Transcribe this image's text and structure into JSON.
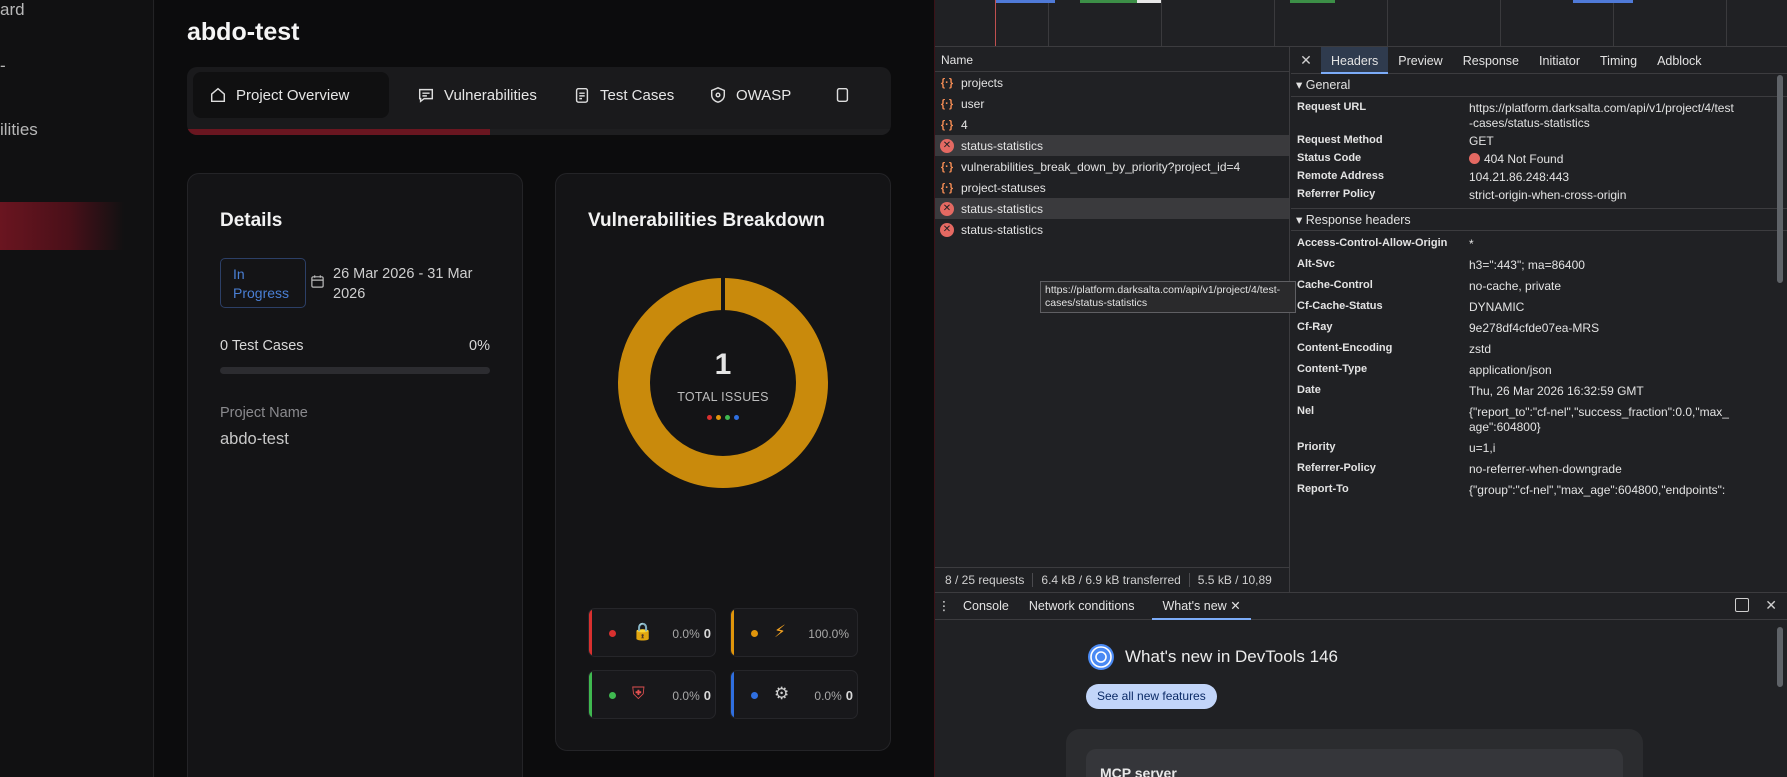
{
  "app": {
    "sidebar": {
      "items": [
        "ard",
        "",
        "ilities"
      ]
    },
    "project_title": "abdo-test",
    "tabs": [
      {
        "label": "Project Overview",
        "icon": "home-icon"
      },
      {
        "label": "Vulnerabilities",
        "icon": "message-icon"
      },
      {
        "label": "Test Cases",
        "icon": "clipboard-icon"
      },
      {
        "label": "OWASP",
        "icon": "shield-icon"
      }
    ],
    "tab_progress": 0.43,
    "details": {
      "title": "Details",
      "status": "In Progress",
      "date_range": "26 Mar 2026 - 31 Mar 2026",
      "test_cases_label": "0 Test Cases",
      "test_cases_pct": "0%",
      "test_cases_progress": 0,
      "project_name_label": "Project Name",
      "project_name": "abdo-test"
    },
    "breakdown": {
      "title": "Vulnerabilities Breakdown",
      "total": "1",
      "total_label": "TOTAL ISSUES",
      "ring_color": "#c98a0c",
      "severities": [
        {
          "name": "critical",
          "color": "#d9302f",
          "icon": "lock-icon",
          "pct": "0.0%",
          "count": "0"
        },
        {
          "name": "high",
          "color": "#e0950b",
          "icon": "lightning-icon",
          "pct": "100.0%",
          "count": ""
        },
        {
          "name": "medium",
          "color": "#3fb950",
          "icon": "shield-badge-icon",
          "pct": "0.0%",
          "count": "0"
        },
        {
          "name": "low",
          "color": "#2f6fe0",
          "icon": "gear-icon",
          "pct": "0.0%",
          "count": "0"
        }
      ]
    }
  },
  "devtools": {
    "list_header": "Name",
    "requests": [
      {
        "name": "projects",
        "type": "xhr",
        "error": false
      },
      {
        "name": "user",
        "type": "xhr",
        "error": false
      },
      {
        "name": "4",
        "type": "xhr",
        "error": false
      },
      {
        "name": "status-statistics",
        "type": "error",
        "error": true
      },
      {
        "name": "vulnerabilities_break_down_by_priority?project_id=4",
        "type": "xhr",
        "error": false
      },
      {
        "name": "project-statuses",
        "type": "xhr",
        "error": false
      },
      {
        "name": "status-statistics",
        "type": "error",
        "error": true
      },
      {
        "name": "status-statistics",
        "type": "error",
        "error": false
      }
    ],
    "tooltip": "https://platform.darksalta.com/api/v1/project/4/test-cases/status-statistics",
    "status_bar": [
      "8 / 25 requests",
      "6.4 kB / 6.9 kB transferred",
      "5.5 kB / 10,89"
    ],
    "detail_tabs": [
      "Headers",
      "Preview",
      "Response",
      "Initiator",
      "Timing",
      "Adblock"
    ],
    "general_title": "General",
    "general": [
      {
        "k": "Request URL",
        "v": "https://platform.darksalta.com/api/v1/project/4/test-cases/status-statistics"
      },
      {
        "k": "Request Method",
        "v": "GET"
      },
      {
        "k": "Status Code",
        "v": "404 Not Found"
      },
      {
        "k": "Remote Address",
        "v": "104.21.86.248:443"
      },
      {
        "k": "Referrer Policy",
        "v": "strict-origin-when-cross-origin"
      }
    ],
    "response_title": "Response headers",
    "response_headers": [
      {
        "k": "Access-Control-Allow-Origin",
        "v": "*"
      },
      {
        "k": "Alt-Svc",
        "v": "h3=\":443\"; ma=86400"
      },
      {
        "k": "Cache-Control",
        "v": "no-cache, private"
      },
      {
        "k": "Cf-Cache-Status",
        "v": "DYNAMIC"
      },
      {
        "k": "Cf-Ray",
        "v": "9e278df4cfde07ea-MRS"
      },
      {
        "k": "Content-Encoding",
        "v": "zstd"
      },
      {
        "k": "Content-Type",
        "v": "application/json"
      },
      {
        "k": "Date",
        "v": "Thu, 26 Mar 2026 16:32:59 GMT"
      },
      {
        "k": "Nel",
        "v": "{\"report_to\":\"cf-nel\",\"success_fraction\":0.0,\"max_age\":604800}"
      },
      {
        "k": "Priority",
        "v": "u=1,i"
      },
      {
        "k": "Referrer-Policy",
        "v": "no-referrer-when-downgrade"
      },
      {
        "k": "Report-To",
        "v": "{\"group\":\"cf-nel\",\"max_age\":604800,\"endpoints\":"
      }
    ],
    "drawer_tabs": [
      "Console",
      "Network conditions",
      "What's new"
    ],
    "whats_new_title": "What's new in DevTools 146",
    "whats_new_button": "See all new features",
    "whats_new_card": "MCP server"
  }
}
